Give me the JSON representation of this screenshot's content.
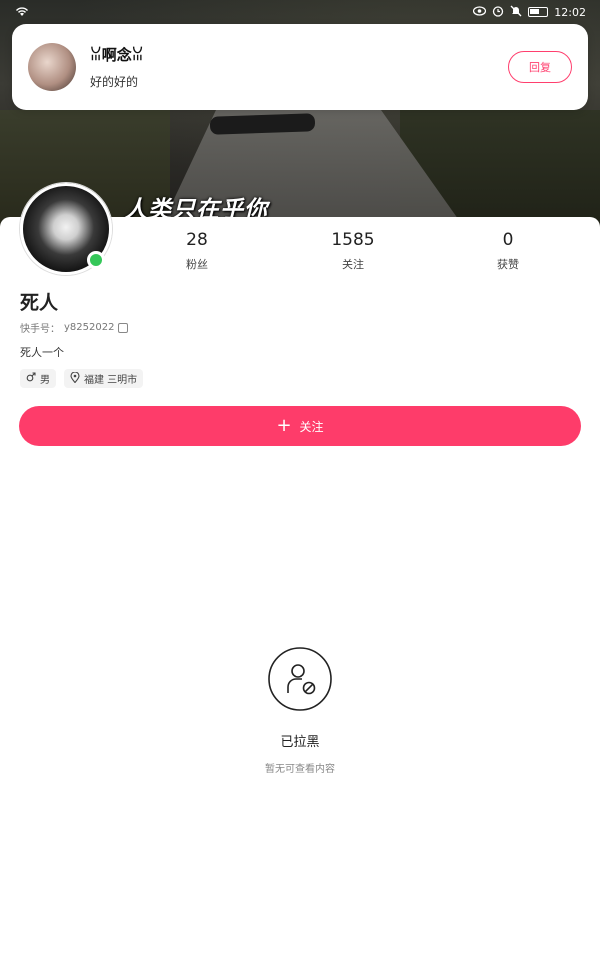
{
  "status_bar": {
    "time": "12:02",
    "icons": [
      "wifi-icon",
      "eye-icon",
      "alarm-icon",
      "mute-icon",
      "battery-icon"
    ]
  },
  "banner": {
    "caption": "人类只在乎你"
  },
  "notification": {
    "sender_name": "ꈍ啊念ꈍ",
    "message": "好的好的",
    "reply_label": "回复"
  },
  "profile": {
    "name": "死人",
    "account_id_label": "快手号：",
    "account_id": "y8252022",
    "bio": "死人一个",
    "online": true,
    "tags": [
      {
        "icon": "male-icon",
        "text": "男"
      },
      {
        "icon": "location-pin-icon",
        "text": "福建 三明市"
      }
    ],
    "stats": {
      "followers": {
        "value": "28",
        "label": "粉丝"
      },
      "following": {
        "value": "1585",
        "label": "关注"
      },
      "likes": {
        "value": "0",
        "label": "获赞"
      }
    },
    "follow_label": "关注"
  },
  "blocked": {
    "title": "已拉黑",
    "subtitle": "暂无可查看内容"
  },
  "colors": {
    "accent": "#fe3c6a",
    "online": "#35c759"
  }
}
